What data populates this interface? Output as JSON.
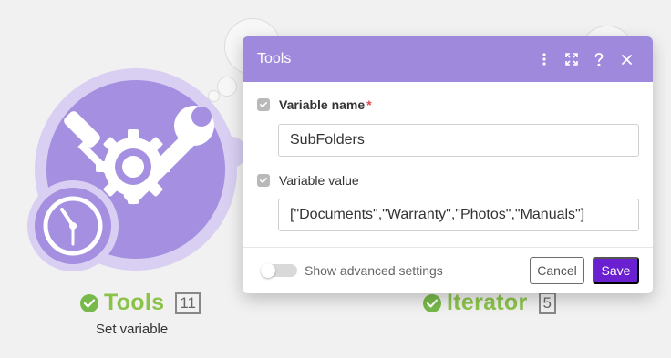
{
  "canvas": {
    "tools_module": {
      "name": "Tools",
      "id": "11",
      "subtitle": "Set variable"
    },
    "iterator_module": {
      "name": "Iterator",
      "id": "5"
    }
  },
  "dialog": {
    "title": "Tools",
    "header_icons": [
      "more-vertical-icon",
      "expand-icon",
      "help-icon",
      "close-icon"
    ],
    "fields": [
      {
        "label": "Variable name",
        "required": true,
        "value": "SubFolders"
      },
      {
        "label": "Variable value",
        "required": false,
        "value": "[\"Documents\",\"Warranty\",\"Photos\",\"Manuals\"]"
      }
    ],
    "advanced_settings_label": "Show advanced settings",
    "advanced_settings_on": false,
    "cancel_label": "Cancel",
    "save_label": "Save"
  },
  "colors": {
    "module_purple": "#a48fe0",
    "header_purple": "#9e89dc",
    "save_purple": "#6a1fd1",
    "status_green": "#77b94a"
  }
}
